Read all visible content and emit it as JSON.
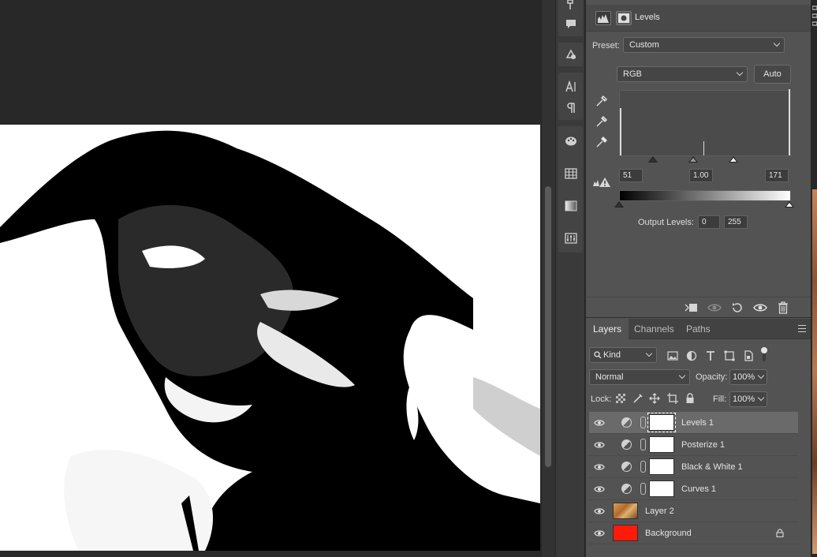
{
  "properties": {
    "title": "Levels",
    "preset_label": "Preset:",
    "preset_value": "Custom",
    "channel_value": "RGB",
    "auto_label": "Auto",
    "input_black": "51",
    "input_gamma": "1.00",
    "input_white": "171",
    "output_label": "Output Levels:",
    "output_black": "0",
    "output_white": "255"
  },
  "layers_panel": {
    "tabs": [
      "Layers",
      "Channels",
      "Paths"
    ],
    "filter_kind": "Kind",
    "blend_mode": "Normal",
    "opacity_label": "Opacity:",
    "opacity_value": "100%",
    "lock_label": "Lock:",
    "fill_label": "Fill:",
    "fill_value": "100%",
    "layers": [
      {
        "name": "Levels 1",
        "type": "adjustment",
        "selected": true
      },
      {
        "name": "Posterize 1",
        "type": "adjustment",
        "selected": false
      },
      {
        "name": "Black & White 1",
        "type": "adjustment",
        "selected": false
      },
      {
        "name": "Curves 1",
        "type": "adjustment",
        "selected": false
      },
      {
        "name": "Layer 2",
        "type": "pixel",
        "selected": false
      },
      {
        "name": "Background",
        "type": "fill",
        "selected": false,
        "locked": true
      }
    ]
  },
  "colors": {
    "background_layer": "#ff1a0a",
    "panel_bg": "#535353",
    "selected_row": "#6a6a6a"
  }
}
